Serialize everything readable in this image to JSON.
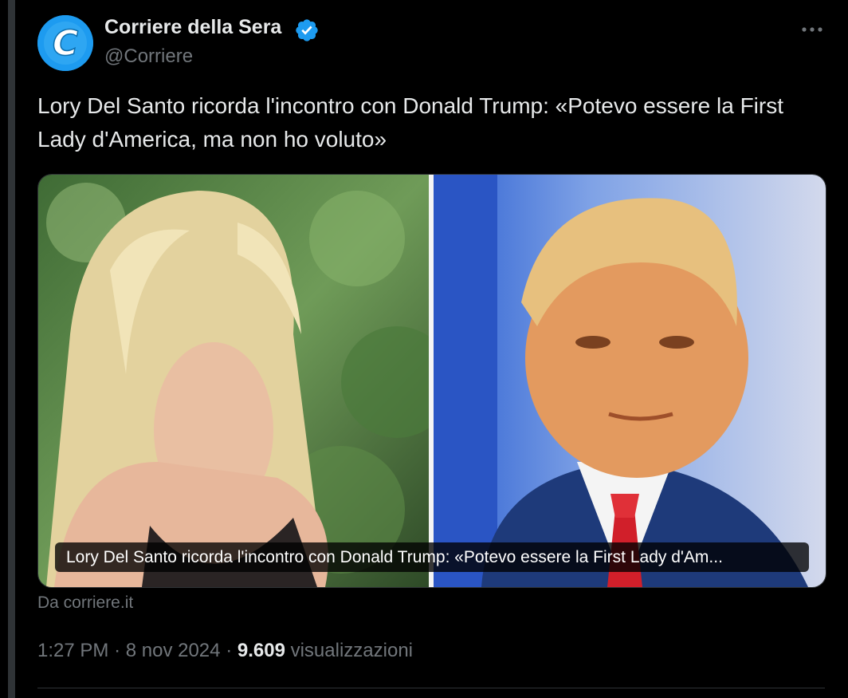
{
  "author": {
    "name": "Corriere della Sera",
    "handle": "@Corriere",
    "logo_letter": "C"
  },
  "tweet": {
    "text": "Lory Del Santo ricorda l'incontro con Donald Trump: «Potevo essere la First Lady d'America, ma non ho voluto»"
  },
  "link_card": {
    "caption": "Lory Del Santo ricorda l'incontro con Donald Trump: «Potevo essere la First Lady d'Am...",
    "source": "Da corriere.it"
  },
  "meta": {
    "time": "1:27 PM",
    "separator": "·",
    "date": "8 nov 2024",
    "views_count": "9.609",
    "views_label": "visualizzazioni"
  },
  "icons": {
    "verified": "verified-badge-icon",
    "more": "more-options-icon"
  },
  "colors": {
    "background": "#000000",
    "text_primary": "#e7e9ea",
    "text_secondary": "#71767b",
    "accent": "#1d9bf0",
    "border": "#2f3336"
  }
}
